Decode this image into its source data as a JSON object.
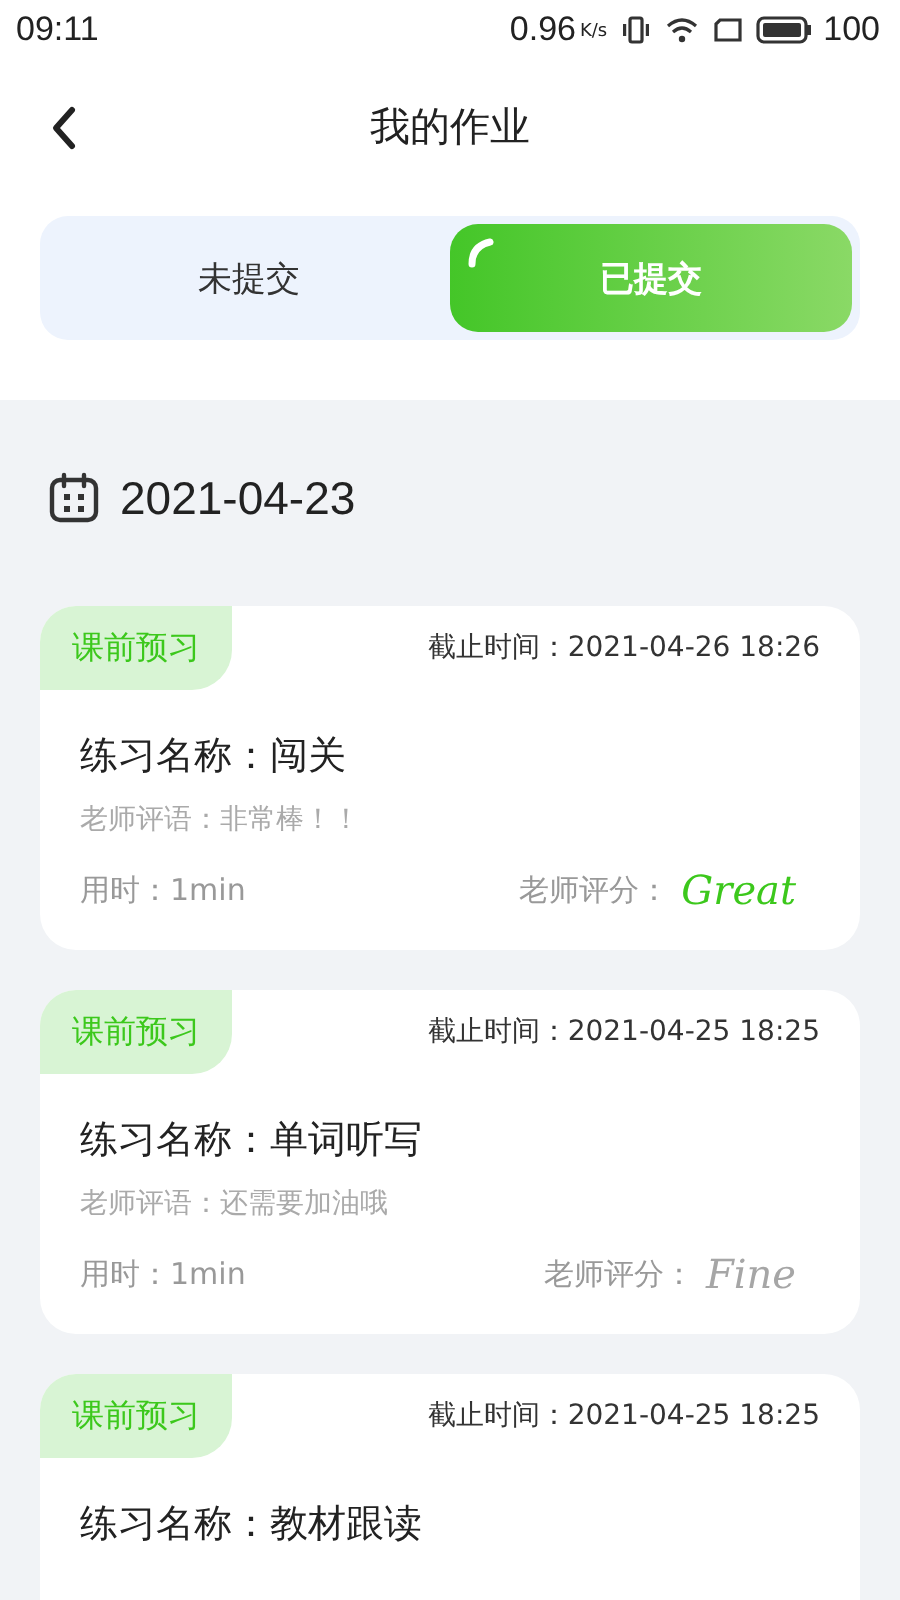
{
  "status_bar": {
    "time": "09:11",
    "speed": "0.96",
    "speed_unit": "K/s",
    "battery": "100"
  },
  "header": {
    "title": "我的作业"
  },
  "tabs": [
    {
      "label": "未提交",
      "selected": false
    },
    {
      "label": "已提交",
      "selected": true
    }
  ],
  "date": "2021-04-23",
  "cards": [
    {
      "tag": "课前预习",
      "deadline": "截止时间：2021-04-26 18:26",
      "name": "练习名称：闯关",
      "comment": "老师评语：非常棒！！",
      "duration": "用时：1min",
      "score_label": "老师评分：",
      "grade": "Great",
      "color": "#3cc81c"
    },
    {
      "tag": "课前预习",
      "deadline": "截止时间：2021-04-25 18:25",
      "name": "练习名称：单词听写",
      "comment": "老师评语：还需要加油哦",
      "duration": "用时：1min",
      "score_label": "老师评分：",
      "grade": "Fine",
      "color": "#a6a6a6"
    },
    {
      "tag": "课前预习",
      "deadline": "截止时间：2021-04-25 18:25",
      "name": "练习名称：教材跟读"
    }
  ]
}
